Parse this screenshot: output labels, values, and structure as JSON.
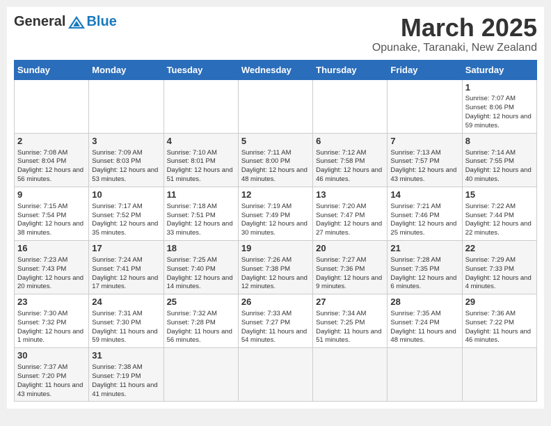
{
  "header": {
    "logo_general": "General",
    "logo_blue": "Blue",
    "month_title": "March 2025",
    "location": "Opunake, Taranaki, New Zealand"
  },
  "weekdays": [
    "Sunday",
    "Monday",
    "Tuesday",
    "Wednesday",
    "Thursday",
    "Friday",
    "Saturday"
  ],
  "weeks": [
    [
      {
        "day": null,
        "info": null
      },
      {
        "day": null,
        "info": null
      },
      {
        "day": null,
        "info": null
      },
      {
        "day": null,
        "info": null
      },
      {
        "day": null,
        "info": null
      },
      {
        "day": null,
        "info": null
      },
      {
        "day": "1",
        "info": "Sunrise: 7:07 AM\nSunset: 8:06 PM\nDaylight: 12 hours and 59 minutes."
      }
    ],
    [
      {
        "day": "2",
        "info": "Sunrise: 7:08 AM\nSunset: 8:04 PM\nDaylight: 12 hours and 56 minutes."
      },
      {
        "day": "3",
        "info": "Sunrise: 7:09 AM\nSunset: 8:03 PM\nDaylight: 12 hours and 53 minutes."
      },
      {
        "day": "4",
        "info": "Sunrise: 7:10 AM\nSunset: 8:01 PM\nDaylight: 12 hours and 51 minutes."
      },
      {
        "day": "5",
        "info": "Sunrise: 7:11 AM\nSunset: 8:00 PM\nDaylight: 12 hours and 48 minutes."
      },
      {
        "day": "6",
        "info": "Sunrise: 7:12 AM\nSunset: 7:58 PM\nDaylight: 12 hours and 46 minutes."
      },
      {
        "day": "7",
        "info": "Sunrise: 7:13 AM\nSunset: 7:57 PM\nDaylight: 12 hours and 43 minutes."
      },
      {
        "day": "8",
        "info": "Sunrise: 7:14 AM\nSunset: 7:55 PM\nDaylight: 12 hours and 40 minutes."
      }
    ],
    [
      {
        "day": "9",
        "info": "Sunrise: 7:15 AM\nSunset: 7:54 PM\nDaylight: 12 hours and 38 minutes."
      },
      {
        "day": "10",
        "info": "Sunrise: 7:17 AM\nSunset: 7:52 PM\nDaylight: 12 hours and 35 minutes."
      },
      {
        "day": "11",
        "info": "Sunrise: 7:18 AM\nSunset: 7:51 PM\nDaylight: 12 hours and 33 minutes."
      },
      {
        "day": "12",
        "info": "Sunrise: 7:19 AM\nSunset: 7:49 PM\nDaylight: 12 hours and 30 minutes."
      },
      {
        "day": "13",
        "info": "Sunrise: 7:20 AM\nSunset: 7:47 PM\nDaylight: 12 hours and 27 minutes."
      },
      {
        "day": "14",
        "info": "Sunrise: 7:21 AM\nSunset: 7:46 PM\nDaylight: 12 hours and 25 minutes."
      },
      {
        "day": "15",
        "info": "Sunrise: 7:22 AM\nSunset: 7:44 PM\nDaylight: 12 hours and 22 minutes."
      }
    ],
    [
      {
        "day": "16",
        "info": "Sunrise: 7:23 AM\nSunset: 7:43 PM\nDaylight: 12 hours and 20 minutes."
      },
      {
        "day": "17",
        "info": "Sunrise: 7:24 AM\nSunset: 7:41 PM\nDaylight: 12 hours and 17 minutes."
      },
      {
        "day": "18",
        "info": "Sunrise: 7:25 AM\nSunset: 7:40 PM\nDaylight: 12 hours and 14 minutes."
      },
      {
        "day": "19",
        "info": "Sunrise: 7:26 AM\nSunset: 7:38 PM\nDaylight: 12 hours and 12 minutes."
      },
      {
        "day": "20",
        "info": "Sunrise: 7:27 AM\nSunset: 7:36 PM\nDaylight: 12 hours and 9 minutes."
      },
      {
        "day": "21",
        "info": "Sunrise: 7:28 AM\nSunset: 7:35 PM\nDaylight: 12 hours and 6 minutes."
      },
      {
        "day": "22",
        "info": "Sunrise: 7:29 AM\nSunset: 7:33 PM\nDaylight: 12 hours and 4 minutes."
      }
    ],
    [
      {
        "day": "23",
        "info": "Sunrise: 7:30 AM\nSunset: 7:32 PM\nDaylight: 12 hours and 1 minute."
      },
      {
        "day": "24",
        "info": "Sunrise: 7:31 AM\nSunset: 7:30 PM\nDaylight: 11 hours and 59 minutes."
      },
      {
        "day": "25",
        "info": "Sunrise: 7:32 AM\nSunset: 7:28 PM\nDaylight: 11 hours and 56 minutes."
      },
      {
        "day": "26",
        "info": "Sunrise: 7:33 AM\nSunset: 7:27 PM\nDaylight: 11 hours and 54 minutes."
      },
      {
        "day": "27",
        "info": "Sunrise: 7:34 AM\nSunset: 7:25 PM\nDaylight: 11 hours and 51 minutes."
      },
      {
        "day": "28",
        "info": "Sunrise: 7:35 AM\nSunset: 7:24 PM\nDaylight: 11 hours and 48 minutes."
      },
      {
        "day": "29",
        "info": "Sunrise: 7:36 AM\nSunset: 7:22 PM\nDaylight: 11 hours and 46 minutes."
      }
    ],
    [
      {
        "day": "30",
        "info": "Sunrise: 7:37 AM\nSunset: 7:20 PM\nDaylight: 11 hours and 43 minutes."
      },
      {
        "day": "31",
        "info": "Sunrise: 7:38 AM\nSunset: 7:19 PM\nDaylight: 11 hours and 41 minutes."
      },
      {
        "day": null,
        "info": null
      },
      {
        "day": null,
        "info": null
      },
      {
        "day": null,
        "info": null
      },
      {
        "day": null,
        "info": null
      },
      {
        "day": null,
        "info": null
      }
    ]
  ]
}
